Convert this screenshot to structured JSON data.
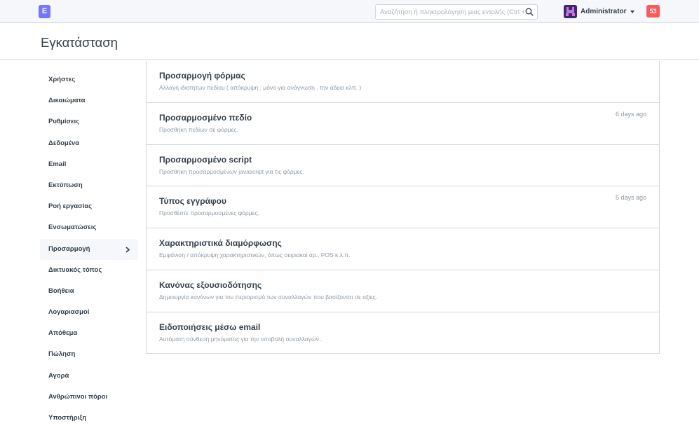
{
  "topbar": {
    "logo_letter": "E",
    "search_placeholder": "Αναζήτηση ή πληκτρολόγηση μιας εντολής (Ctrl + G)",
    "user_name": "Administrator",
    "notification_count": "53"
  },
  "page": {
    "title": "Εγκατάσταση"
  },
  "sidebar": {
    "items": [
      {
        "label": "Χρήστες"
      },
      {
        "label": "Δικαιώματα"
      },
      {
        "label": "Ρυθμίσεις"
      },
      {
        "label": "Δεδομένα"
      },
      {
        "label": "Email"
      },
      {
        "label": "Εκτύπωση"
      },
      {
        "label": "Ροή εργασίας"
      },
      {
        "label": "Ενσωματώσεις"
      },
      {
        "label": "Προσαρμογή"
      },
      {
        "label": "Δικτυακός τόπος"
      },
      {
        "label": "Βοήθεια"
      },
      {
        "label": "Λογαριασμοί"
      },
      {
        "label": "Απόθεμα"
      },
      {
        "label": "Πώληση"
      },
      {
        "label": "Αγορά"
      },
      {
        "label": "Ανθρώπινοι πόροι"
      },
      {
        "label": "Υποστήριξη"
      }
    ],
    "active_label": "Προσαρμογή"
  },
  "cards": [
    {
      "title": "Προσαρμογή φόρμας",
      "description": "Αλλαγή ιδιοτήτων πεδίου ( απόκρυψη , μόνο για ανάγνωση , την άδεια κλπ. )",
      "time": ""
    },
    {
      "title": "Προσαρμοσμένο πεδίο",
      "description": "Προσθήκη πεδίων σε φόρμες.",
      "time": "6 days ago"
    },
    {
      "title": "Προσαρμοσμένο script",
      "description": "Προσθήκη προσαρμοσμένων javascript για τις φόρμες.",
      "time": ""
    },
    {
      "title": "Τύπος εγγράφου",
      "description": "Προσθέστε προσαρμοσμένες φόρμες.",
      "time": "5 days ago"
    },
    {
      "title": "Χαρακτηριστικά διαμόρφωσης",
      "description": "Εμφάνιση / απόκρυψη χαρακτηριστικών, όπως σειριακοί αρ., POS κ.λ.π.",
      "time": ""
    },
    {
      "title": "Κανόνας εξουσιοδότησης",
      "description": "Δημιουργία κανόνων για τον περιορισμό των συναλλαγών που βασίζονται σε αξίες.",
      "time": ""
    },
    {
      "title": "Ειδοποιήσεις μέσω email",
      "description": "Αυτόματη σύνθεση μηνύματος για την υποβολή συναλλαγών .",
      "time": ""
    }
  ],
  "colors": {
    "brand": "#7575ff",
    "notification": "#ff5858",
    "text": "#36414c",
    "muted": "#8d99a6",
    "border": "#d1d8dd"
  }
}
